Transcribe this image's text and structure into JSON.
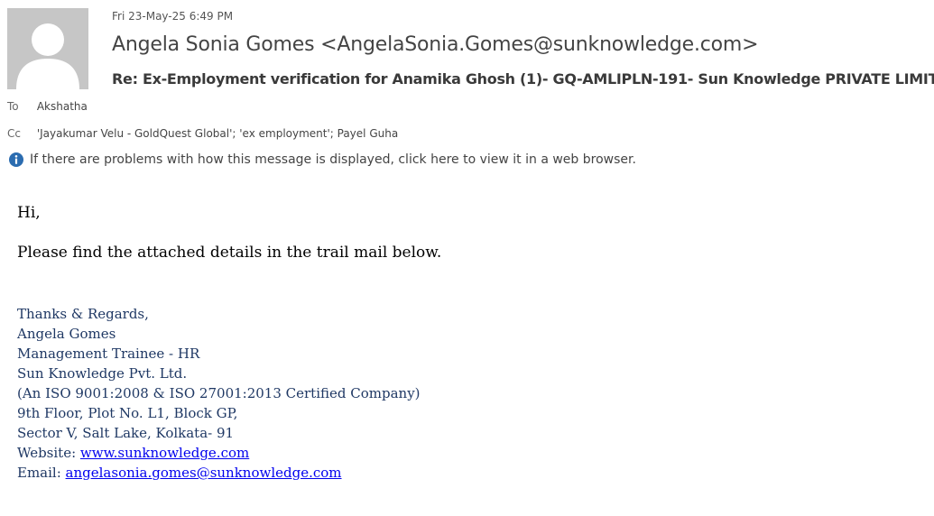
{
  "header": {
    "date": "Fri 23-May-25 6:49 PM",
    "sender": "Angela Sonia Gomes <AngelaSonia.Gomes@sunknowledge.com>",
    "subject": "Re: Ex-Employment verification for Anamika Ghosh (1)- GQ-AMLIPLN-191- Sun Knowledge PRIVATE LIMITED"
  },
  "recipients": {
    "to_label": "To",
    "to_value": "Akshatha",
    "cc_label": "Cc",
    "cc_value": "'Jayakumar Velu - GoldQuest Global'; 'ex employment'; Payel Guha"
  },
  "info_bar": {
    "icon": "info-icon",
    "text": "If there are problems with how this message is displayed, click here to view it in a web browser."
  },
  "body": {
    "greeting": "Hi,",
    "message": "Please find the attached details in the trail mail below."
  },
  "signature": {
    "closing": "Thanks & Regards,",
    "name": "Angela Gomes",
    "title": "Management Trainee - HR",
    "company": "Sun Knowledge Pvt. Ltd.",
    "certification": "(An ISO 9001:2008 & ISO 27001:2013 Certified Company)",
    "address_line1": "9th Floor, Plot No. L1, Block GP,",
    "address_line2": "Sector V, Salt Lake, Kolkata- 91",
    "website_label": "Website: ",
    "website_link": "www.sunknowledge.com ",
    "email_label": "Email: ",
    "email_link": "angelasonia.gomes@sunknowledge.com "
  },
  "colors": {
    "signature_text": "#1f3864",
    "link": "#0000ee",
    "info_icon": "#2b6cb0",
    "avatar_bg": "#c6c6c6"
  }
}
